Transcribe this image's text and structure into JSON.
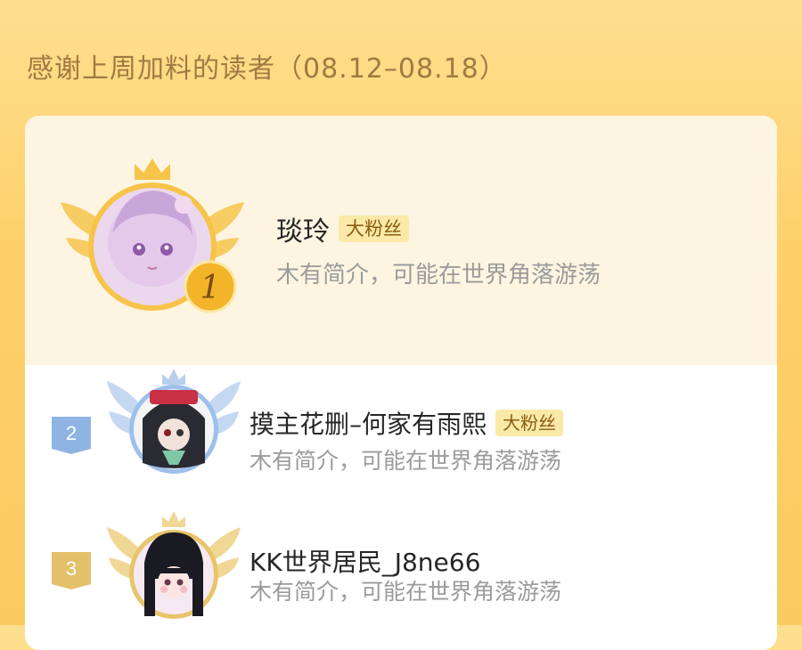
{
  "header": {
    "title": "感谢上周加料的读者（08.12–08.18）"
  },
  "colors": {
    "gold": "#f5b92c",
    "silver": "#8fb4e3",
    "bronze": "#e7c765",
    "badge_bg": "#fbe9a7",
    "badge_text": "#8a5d12"
  },
  "readers": [
    {
      "rank": "1",
      "name": "琰玲",
      "badge": "大粉丝",
      "bio": "木有简介，可能在世界角落游荡"
    },
    {
      "rank": "2",
      "name": "摸主花删–何家有雨熙",
      "badge": "大粉丝",
      "bio": "木有简介，可能在世界角落游荡"
    },
    {
      "rank": "3",
      "name": "KK世界居民_J8ne66",
      "bio": "木有简介，可能在世界角落游荡"
    }
  ]
}
